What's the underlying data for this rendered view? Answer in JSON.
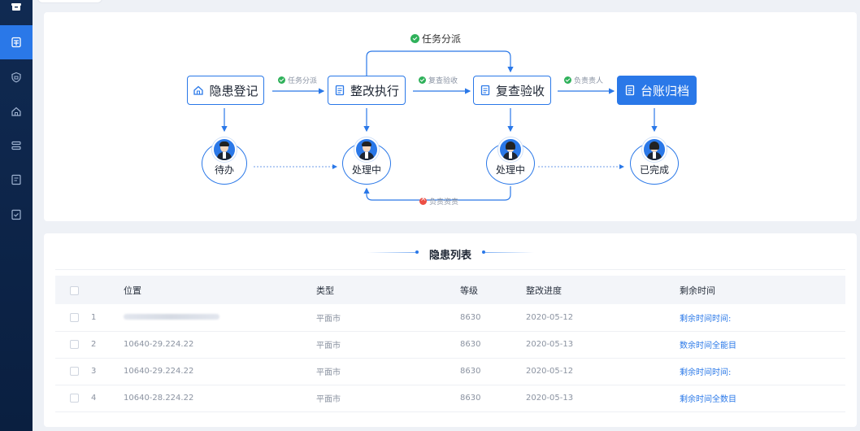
{
  "flow": {
    "nodes": [
      {
        "label": "隐患登记",
        "icon": "shield-home-icon"
      },
      {
        "label": "整改执行",
        "icon": "document-icon"
      },
      {
        "label": "复查验收",
        "icon": "document-icon"
      },
      {
        "label": "台账归档",
        "icon": "document-icon"
      }
    ],
    "edge_labels": {
      "top": "任务分派",
      "e1": "任务分派",
      "e2": "复查验收",
      "e3": "负责责人",
      "bottom": "负责资责"
    },
    "statuses": [
      "待办",
      "处理中",
      "处理中",
      "已完成"
    ]
  },
  "list": {
    "title": "隐患列表",
    "columns": [
      "位置",
      "类型",
      "等级",
      "整改进度",
      "剩余时间"
    ],
    "rows": [
      {
        "no": "1",
        "location": "",
        "type": "平面市",
        "level": "8630",
        "progress": "2020-05-12",
        "remaining": "剩余时间时间:"
      },
      {
        "no": "2",
        "location": "10640-29.224.22",
        "type": "平面市",
        "level": "8630",
        "progress": "2020-05-13",
        "remaining": "数余时间全能目"
      },
      {
        "no": "3",
        "location": "10640-29.224.22",
        "type": "平面市",
        "level": "8630",
        "progress": "2020-05-12",
        "remaining": "剩余时间时间:"
      },
      {
        "no": "4",
        "location": "10640-28.224.22",
        "type": "平面市",
        "level": "8630",
        "progress": "2020-05-13",
        "remaining": "剩余时间全数目"
      }
    ]
  },
  "colors": {
    "accent": "#2a78e8",
    "sidebar": "#102a52",
    "ok": "#2fb15a",
    "error": "#ec4e44"
  },
  "sidebar_icons": [
    "box-icon",
    "calculator-icon",
    "shield-icon",
    "home-icon",
    "list-icon",
    "form-icon",
    "check-shield-icon"
  ]
}
